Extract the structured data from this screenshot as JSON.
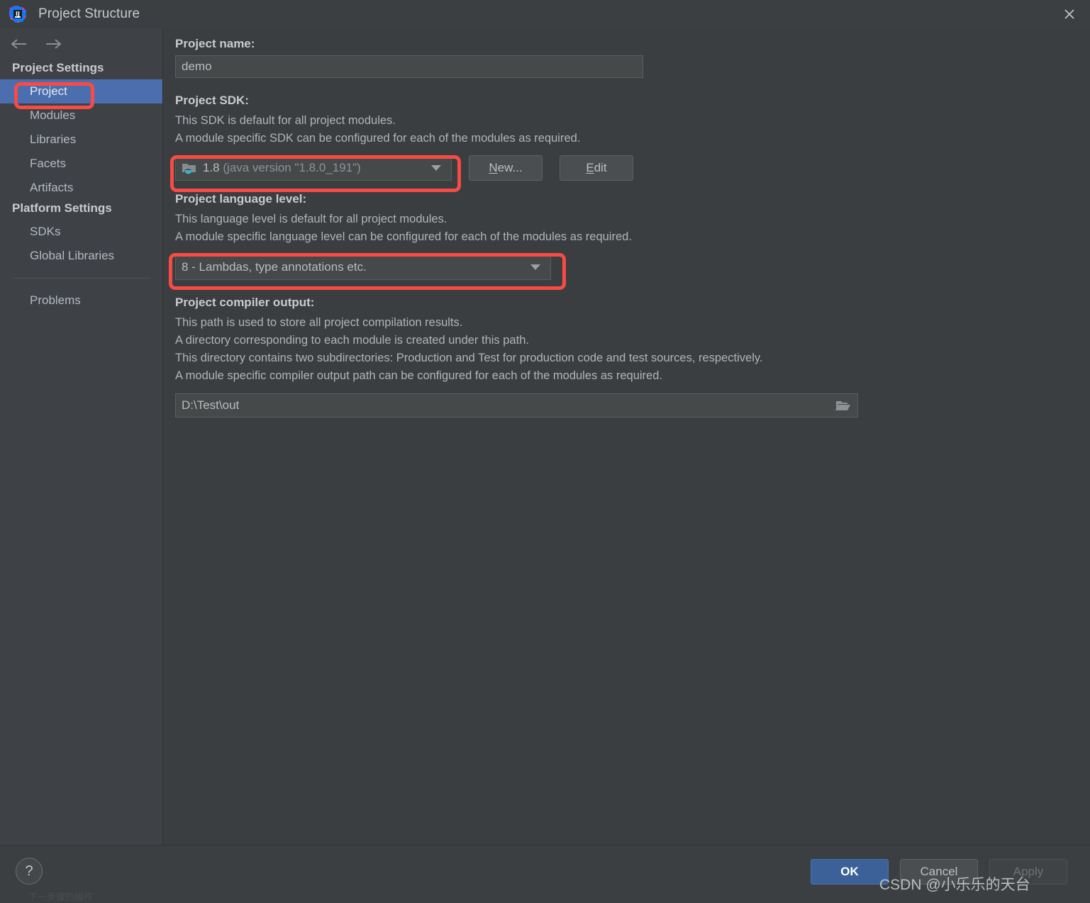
{
  "window": {
    "title": "Project Structure",
    "logo_icon": "intellij-idea-logo",
    "close_icon": "close-icon"
  },
  "sidebar": {
    "back_icon": "arrow-left-icon",
    "forward_icon": "arrow-right-icon",
    "groups": [
      {
        "header": "Project Settings",
        "items": [
          {
            "label": "Project",
            "selected": true
          },
          {
            "label": "Modules",
            "selected": false
          },
          {
            "label": "Libraries",
            "selected": false
          },
          {
            "label": "Facets",
            "selected": false
          },
          {
            "label": "Artifacts",
            "selected": false
          }
        ]
      },
      {
        "header": "Platform Settings",
        "items": [
          {
            "label": "SDKs",
            "selected": false
          },
          {
            "label": "Global Libraries",
            "selected": false
          }
        ]
      }
    ],
    "footer_items": [
      {
        "label": "Problems",
        "selected": false
      }
    ]
  },
  "main": {
    "project_name": {
      "label": "Project name:",
      "value": "demo"
    },
    "project_sdk": {
      "label": "Project SDK:",
      "description": [
        "This SDK is default for all project modules.",
        "A module specific SDK can be configured for each of the modules as required."
      ],
      "sdk_icon": "java-sdk-folder-icon",
      "selected_version": "1.8",
      "selected_detail": "(java version \"1.8.0_191\")",
      "new_button": {
        "prefix": "",
        "mnemonic": "N",
        "suffix": "ew..."
      },
      "edit_button": {
        "prefix": "",
        "mnemonic": "E",
        "suffix": "dit"
      }
    },
    "language_level": {
      "label": "Project language level:",
      "description": [
        "This language level is default for all project modules.",
        "A module specific language level can be configured for each of the modules as required."
      ],
      "selected": "8 - Lambdas, type annotations etc."
    },
    "compiler_output": {
      "label": "Project compiler output:",
      "description": [
        "This path is used to store all project compilation results.",
        "A directory corresponding to each module is created under this path.",
        "This directory contains two subdirectories: Production and Test for production code and test sources, respectively.",
        "A module specific compiler output path can be configured for each of the modules as required."
      ],
      "value": "D:\\Test\\out",
      "browse_icon": "folder-open-icon"
    }
  },
  "bottom": {
    "help_label": "?",
    "ok_label": "OK",
    "cancel_label": "Cancel",
    "apply_label": "Apply"
  },
  "watermark": "CSDN @小乐乐的天台",
  "bottom_artifact": "下一步骤的操作",
  "colors": {
    "selection_blue": "#4b6eaf",
    "annotation_red": "#f74b44",
    "primary_button": "#3c6198",
    "sidebar_bg": "#3e4247",
    "main_bg": "#3b3e40",
    "titlebar_bg": "#3c3f41"
  }
}
